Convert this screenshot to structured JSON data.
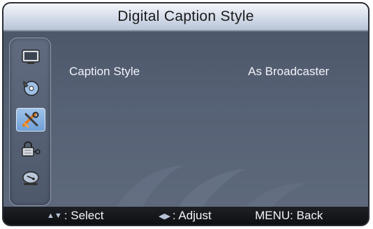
{
  "title": "Digital Caption Style",
  "sidebar": {
    "items": [
      {
        "icon": "tv-screen-icon"
      },
      {
        "icon": "audio-disc-icon"
      },
      {
        "icon": "setup-tools-icon",
        "active": true
      },
      {
        "icon": "lock-key-icon"
      },
      {
        "icon": "satellite-dish-icon"
      }
    ]
  },
  "settings": {
    "caption_style_label": "Caption Style",
    "caption_style_value": "As Broadcaster"
  },
  "footer": {
    "select_label": ": Select",
    "adjust_label": ": Adjust",
    "back_label": "MENU: Back"
  }
}
